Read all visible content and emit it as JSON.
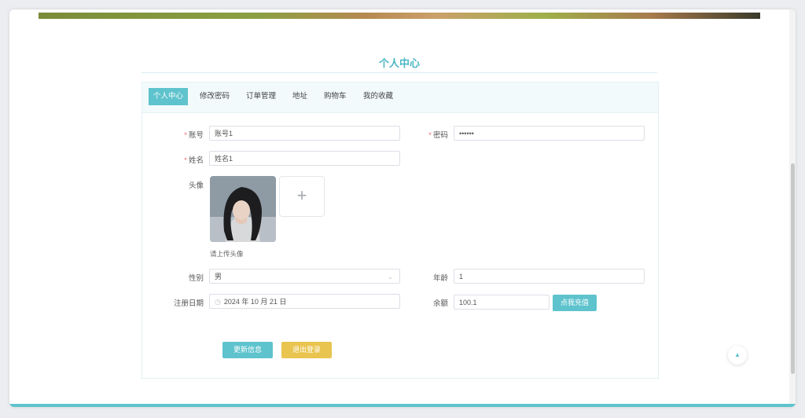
{
  "page": {
    "title": "个人中心"
  },
  "tabs": [
    {
      "label": "个人中心",
      "active": true
    },
    {
      "label": "修改密码",
      "active": false
    },
    {
      "label": "订单管理",
      "active": false
    },
    {
      "label": "地址",
      "active": false
    },
    {
      "label": "购物车",
      "active": false
    },
    {
      "label": "我的收藏",
      "active": false
    }
  ],
  "form": {
    "account": {
      "label": "账号",
      "value": "账号1"
    },
    "password": {
      "label": "密码",
      "value": "••••••"
    },
    "name": {
      "label": "姓名",
      "value": "姓名1"
    },
    "avatar": {
      "label": "头像",
      "hint": "请上传头像",
      "upload_icon": "+"
    },
    "gender": {
      "label": "性别",
      "value": "男"
    },
    "age": {
      "label": "年龄",
      "value": "1"
    },
    "register_date": {
      "label": "注册日期",
      "value": "2024 年 10 月 21 日"
    },
    "balance": {
      "label": "余额",
      "value": "100.1"
    }
  },
  "buttons": {
    "recharge": "点我充值",
    "update": "更新信息",
    "logout": "退出登录"
  },
  "icons": {
    "clock": "clock-icon",
    "chevron": "chevron-down-icon",
    "scroll_top": "arrow-up-icon"
  },
  "colors": {
    "accent": "#5ec3cd",
    "warning": "#e9c44e",
    "required": "#f56c6c"
  }
}
